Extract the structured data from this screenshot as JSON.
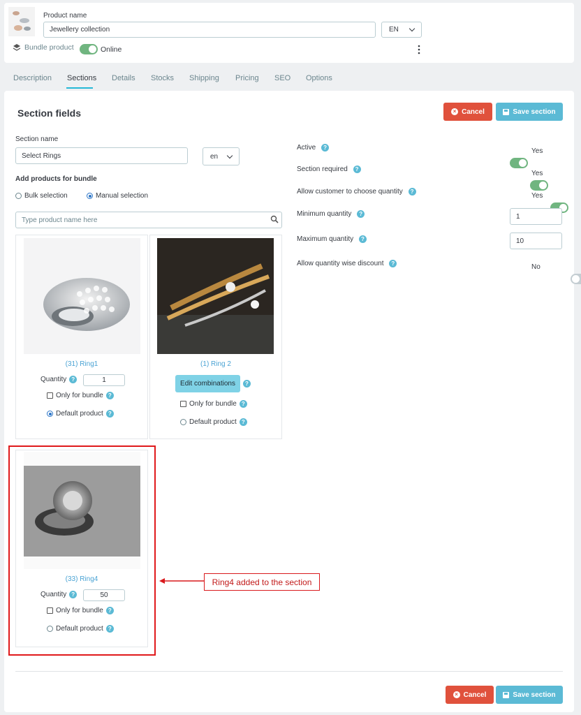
{
  "header": {
    "product_name_label": "Product name",
    "product_name_value": "Jewellery collection",
    "language": "EN",
    "product_type": "Bundle product",
    "status_label": "Online"
  },
  "tabs": [
    "Description",
    "Sections",
    "Details",
    "Stocks",
    "Shipping",
    "Pricing",
    "SEO",
    "Options"
  ],
  "active_tab": "Sections",
  "section": {
    "title": "Section fields",
    "cancel_label": "Cancel",
    "save_label": "Save section",
    "name_label": "Section name",
    "name_value": "Select Rings",
    "lang_value": "en",
    "add_products_label": "Add products for bundle",
    "bulk_selection": "Bulk selection",
    "manual_selection": "Manual selection",
    "search_placeholder": "Type product name here"
  },
  "products": [
    {
      "title": "(31) Ring1",
      "quantity_label": "Quantity",
      "quantity": "1",
      "only_bundle": "Only for bundle",
      "default_product": "Default product",
      "is_default": true
    },
    {
      "title": "(1) Ring 2",
      "edit_combinations": "Edit combinations",
      "only_bundle": "Only for bundle",
      "default_product": "Default product",
      "is_default": false
    },
    {
      "title": "(33) Ring4",
      "quantity_label": "Quantity",
      "quantity": "50",
      "only_bundle": "Only for bundle",
      "default_product": "Default product",
      "is_default": false
    }
  ],
  "settings": {
    "active_label": "Active",
    "active_value": "Yes",
    "required_label": "Section required",
    "required_value": "Yes",
    "choose_qty_label": "Allow customer to choose quantity",
    "choose_qty_value": "Yes",
    "min_qty_label": "Minimum quantity",
    "min_qty_value": "1",
    "max_qty_label": "Maximum quantity",
    "max_qty_value": "10",
    "qty_discount_label": "Allow quantity wise discount",
    "qty_discount_value": "No"
  },
  "annotation": "Ring4 added to the section",
  "footer": {
    "cancel_label": "Cancel",
    "save_label": "Save section"
  },
  "colors": {
    "accent": "#25b9d7",
    "danger": "#e0513c",
    "info": "#5bbad5",
    "success": "#70b580",
    "annotation": "#e0191b"
  }
}
